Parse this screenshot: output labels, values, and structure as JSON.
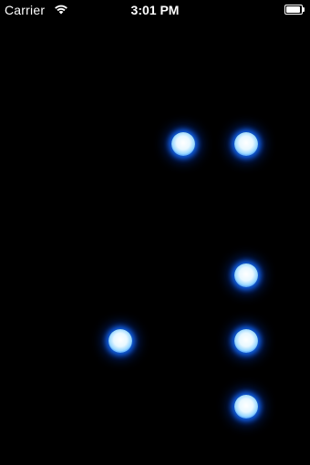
{
  "status_bar": {
    "carrier": "Carrier",
    "time": "3:01 PM",
    "wifi_icon": "wifi-icon",
    "battery_icon": "battery-full-icon"
  },
  "colors": {
    "background": "#000000",
    "dot_glow": "#1e6cff",
    "dot_core": "#ffffff"
  },
  "dots": [
    {
      "id": "dot-1",
      "col": 2,
      "row": 0
    },
    {
      "id": "dot-2",
      "col": 3,
      "row": 0
    },
    {
      "id": "dot-3",
      "col": 3,
      "row": 2
    },
    {
      "id": "dot-4",
      "col": 1,
      "row": 3
    },
    {
      "id": "dot-5",
      "col": 3,
      "row": 3
    },
    {
      "id": "dot-6",
      "col": 3,
      "row": 4
    }
  ]
}
